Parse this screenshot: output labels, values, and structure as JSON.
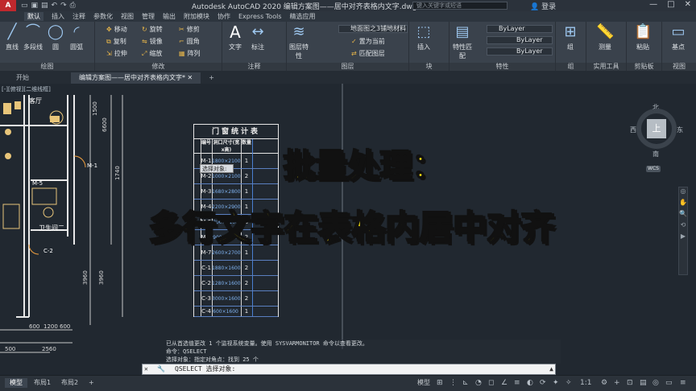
{
  "app": {
    "title": "Autodesk AutoCAD 2020    编辑方案图——居中对齐表格内文字.dwg",
    "logo": "A",
    "search_placeholder": "键入关键字或短语",
    "login": "登录"
  },
  "ribbon_tabs": [
    "默认",
    "插入",
    "注释",
    "参数化",
    "视图",
    "管理",
    "输出",
    "附加模块",
    "协作",
    "Express Tools",
    "精选应用"
  ],
  "ribbon": {
    "draw": {
      "label": "绘图",
      "line": "直线",
      "polyline": "多段线",
      "circle": "圆",
      "arc": "圆弧"
    },
    "modify": {
      "label": "修改",
      "move": "移动",
      "rotate": "旋转",
      "trim": "修剪",
      "copy": "复制",
      "mirror": "镜像",
      "fillet": "圆角",
      "stretch": "拉伸",
      "scale": "缩放",
      "array": "阵列"
    },
    "annotation": {
      "label": "注释",
      "text": "文字",
      "dimension": "标注"
    },
    "layers": {
      "label": "图层",
      "layer_props": "图层特性",
      "current_layer": "地面图之3铺地材料",
      "make_current": "置为当前",
      "match_layer": "匹配图层"
    },
    "block": {
      "label": "块",
      "insert": "插入"
    },
    "properties": {
      "label": "特性",
      "match": "特性匹配",
      "color": "ByLayer",
      "linetype": "ByLayer",
      "lineweight": "ByLayer"
    },
    "groups": {
      "label": "组",
      "group": "组"
    },
    "utilities": {
      "label": "实用工具",
      "measure": "测量"
    },
    "clipboard": {
      "label": "剪贴板",
      "paste": "粘贴"
    },
    "view": {
      "label": "视图",
      "base": "基点"
    }
  },
  "doc_tabs": [
    "开始",
    "编辑方案图——居中对齐表格内文字*"
  ],
  "viewport": {
    "label": "[-][俯视][二维线框]",
    "room_kitchen": "客厅",
    "room_toilet": "卫生间二",
    "compass": {
      "north": "北",
      "south": "南",
      "east": "东",
      "west": "西",
      "top": "上",
      "wcs": "WCS"
    },
    "dims_left": [
      "1500",
      "6600",
      "1740",
      "3960",
      "3960",
      "600",
      "1200",
      "600",
      "2560",
      "500"
    ],
    "door_tags": [
      "M-1",
      "M-5",
      "C-2"
    ]
  },
  "schedule": {
    "title": "门窗统计表",
    "headers": [
      "编号",
      "洞口尺寸(宽x高)",
      "数量"
    ],
    "rows": [
      {
        "id": "M-1",
        "size": "1800×2100",
        "qty": "1"
      },
      {
        "id": "M-2",
        "size": "1000×2100",
        "qty": "2"
      },
      {
        "id": "M-3",
        "size": "1680×2800",
        "qty": "1"
      },
      {
        "id": "M-4",
        "size": "2200×2900",
        "qty": "1"
      },
      {
        "id": "M-5",
        "size": "800×2100",
        "qty": "3"
      },
      {
        "id": "M-6",
        "size": "900×2100",
        "qty": "2"
      },
      {
        "id": "M-7",
        "size": "2600×2700",
        "qty": "1"
      },
      {
        "id": "C-1",
        "size": "1880×1600",
        "qty": "2"
      },
      {
        "id": "C-2",
        "size": "1280×1600",
        "qty": "2"
      },
      {
        "id": "C-3",
        "size": "3000×1600",
        "qty": "2"
      },
      {
        "id": "C-4",
        "size": "600×1600",
        "qty": "1"
      }
    ],
    "side_label": "窗"
  },
  "tooltip": "选择对象:",
  "overlay": {
    "line1": "批量处理：",
    "line2": "多行文字在表格内居中对齐"
  },
  "command": {
    "history": [
      "已从首选值更改 1 个监视系统变量。使用 SYSVARMONITOR 命令以查看更改。",
      "命令：QSELECT",
      "选择对象：指定对角点：找到 25 个"
    ],
    "prompt": "QSELECT 选择对象:"
  },
  "layout_tabs": [
    "模型",
    "布局1",
    "布局2",
    "+"
  ],
  "status": {
    "model": "模型",
    "scale": "1:1"
  }
}
